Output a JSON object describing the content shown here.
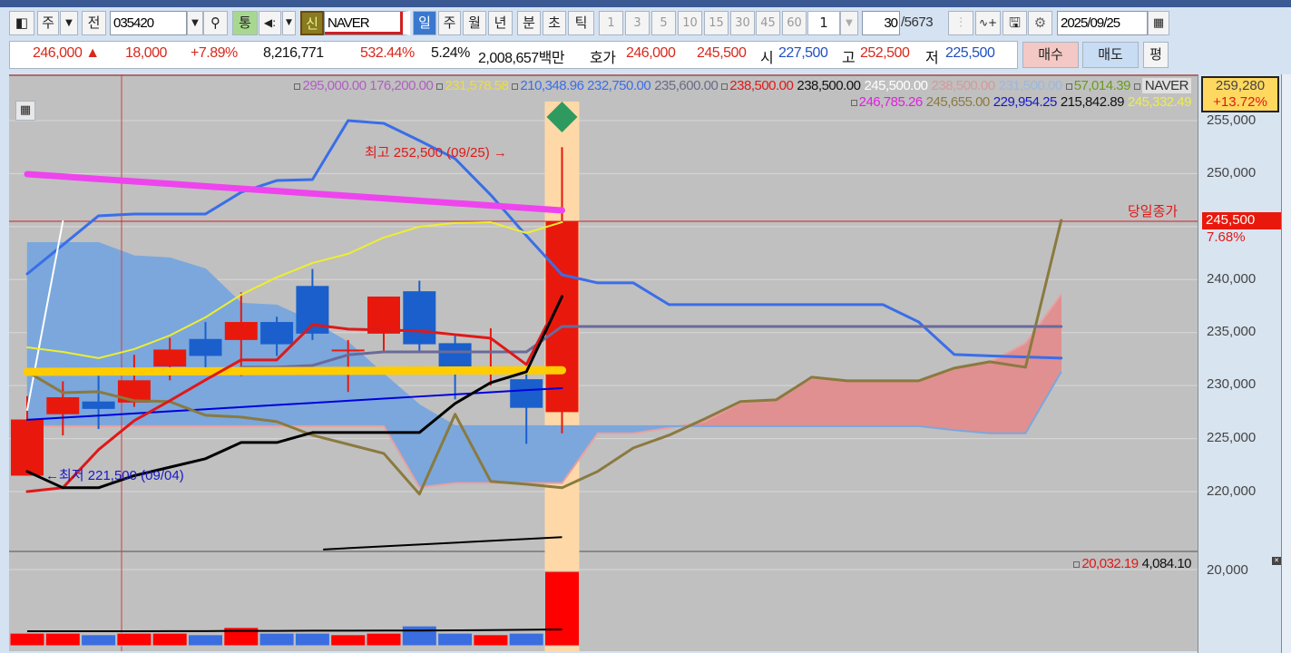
{
  "toolbar": {
    "market": "주",
    "prev": "전",
    "code": "035420",
    "tong": "통",
    "sin": "신",
    "name": "NAVER",
    "periods": [
      "일",
      "주",
      "월",
      "년",
      "분",
      "초",
      "틱"
    ],
    "intervals": [
      "1",
      "3",
      "5",
      "10",
      "15",
      "30",
      "45",
      "60"
    ],
    "multiplier": "1",
    "count": "30",
    "total": "/5673",
    "date": "2025/09/25"
  },
  "quote": {
    "price": "246,000",
    "arrow": "▲",
    "change": "18,000",
    "change_pct": "+7.89%",
    "volume": "8,216,771",
    "vol_ratio": "532.44%",
    "turnover": "5.24%",
    "amount": "2,008,657백만",
    "hoga_label": "호가",
    "ask": "246,000",
    "bid": "245,500",
    "open_label": "시",
    "open": "227,500",
    "high_label": "고",
    "high": "252,500",
    "low_label": "저",
    "low": "225,500",
    "buy": "매수",
    "sell": "매도",
    "eval": "평"
  },
  "legend": {
    "row1": [
      {
        "text": "295,000.00 176,200.00",
        "color": "#b060c0",
        "box": true
      },
      {
        "text": "231,578.58",
        "color": "#eedc40",
        "box": true
      },
      {
        "text": "210,348.96 232,750.00",
        "color": "#3a6ee8",
        "box": true
      },
      {
        "text": "235,600.00",
        "color": "#6a6a8a",
        "box": false
      },
      {
        "text": "238,500.00",
        "color": "#e01818",
        "box": true
      },
      {
        "text": "238,500.00",
        "color": "#111111",
        "box": false
      },
      {
        "text": "245,500.00",
        "color": "#ffffff",
        "box": false
      },
      {
        "text": "238,500.00",
        "color": "#d49a9a",
        "box": false
      },
      {
        "text": "231,500.00",
        "color": "#9ab8e0",
        "box": false
      },
      {
        "text": "57,014.39",
        "color": "#6a9a20",
        "box": true
      },
      {
        "text": "NAVER",
        "color": "#333333",
        "box": true
      }
    ],
    "row2": [
      {
        "text": "246,785.26",
        "color": "#e020e0",
        "box": true
      },
      {
        "text": "245,655.00",
        "color": "#8a7a40",
        "box": false
      },
      {
        "text": "229,954.25",
        "color": "#1818c8",
        "box": false
      },
      {
        "text": "215,842.89",
        "color": "#111111",
        "box": false
      },
      {
        "text": "245,332.49",
        "color": "#eeee40",
        "box": false
      }
    ],
    "volume": [
      {
        "text": "20,032.19",
        "color": "#e01818",
        "box": true
      },
      {
        "text": "4,084.10",
        "color": "#111111",
        "box": false
      }
    ]
  },
  "axis": {
    "price_ticks": [
      "255,000",
      "250,000",
      "240,000",
      "235,000",
      "230,000",
      "225,000",
      "220,000"
    ],
    "current_price": "245,500",
    "current_pct": "7.68%",
    "max_box_price": "259,280",
    "max_box_pct": "+13.72%",
    "volume_tick": "20,000",
    "close_line_label": "당일종가"
  },
  "annotations": {
    "high": "최고 252,500 (09/25) →",
    "low": "←최저 221,500 (09/04)"
  },
  "chart_data": {
    "type": "candlestick",
    "up_color": "#e8190c",
    "down_color": "#1a5fcc",
    "ylim": [
      213000,
      258000
    ],
    "candles": [
      [
        221500,
        229000,
        221500,
        226800
      ],
      [
        227300,
        230400,
        225300,
        228900
      ],
      [
        228500,
        231200,
        225900,
        227800
      ],
      [
        228400,
        232900,
        228000,
        230500
      ],
      [
        231800,
        234500,
        230500,
        233400
      ],
      [
        234400,
        236000,
        231300,
        232800
      ],
      [
        234300,
        238800,
        230900,
        236000
      ],
      [
        236000,
        236500,
        232800,
        233900
      ],
      [
        239400,
        241000,
        234300,
        234900
      ],
      [
        233400,
        234300,
        229400,
        233400
      ],
      [
        234900,
        238400,
        233300,
        238400
      ],
      [
        238900,
        239900,
        233300,
        233900
      ],
      [
        234000,
        234700,
        228700,
        231700
      ],
      [
        231700,
        235400,
        230000,
        231700
      ],
      [
        230600,
        231700,
        224500,
        227900
      ],
      [
        227500,
        252500,
        225500,
        245500
      ]
    ],
    "volumes": [
      3300,
      3300,
      2900,
      3300,
      3300,
      2900,
      4800,
      3300,
      3300,
      2900,
      3300,
      5200,
      3300,
      2900,
      3300,
      19500
    ],
    "volume_ma": [
      3800,
      3800,
      3800,
      3800,
      3850,
      3850,
      3900,
      3900,
      3950,
      3950,
      4000,
      4000,
      4050,
      4100,
      4200,
      4300
    ],
    "cloud": {
      "span_a": [
        226170,
        226170,
        226170,
        226170,
        226170,
        226170,
        226170,
        226170,
        226170,
        226170,
        226170,
        220400,
        220800,
        220800,
        220800,
        220800,
        225500,
        225500,
        226000,
        226600,
        228400,
        228600,
        230700,
        230450,
        230450,
        230450,
        231600,
        232200,
        234000,
        238600
      ],
      "span_b": [
        243450,
        243450,
        243450,
        242200,
        242000,
        240970,
        237720,
        237550,
        236010,
        234040,
        231050,
        228140,
        226170,
        226170,
        226170,
        226170,
        226170,
        226170,
        226170,
        226170,
        226170,
        226170,
        226170,
        226170,
        226170,
        226170,
        225800,
        225500,
        225500,
        231300
      ],
      "up_color": "#e09090",
      "down_color": "#7ba7dc"
    },
    "lines": [
      {
        "color": "#3a6ee8",
        "width": 3,
        "values": [
          240540,
          243270,
          246020,
          246190,
          246190,
          246190,
          248240,
          249350,
          249440,
          255000,
          254740,
          253120,
          251410,
          247990,
          244140,
          240460,
          239690,
          239690,
          237640,
          237640,
          237640,
          237640,
          237640,
          237640,
          237640,
          236010,
          232930,
          232800,
          232700,
          232590
        ]
      },
      {
        "color": "#ffffff",
        "width": 2,
        "values": [
          227700,
          245500
        ]
      },
      {
        "color": "#ee44ee",
        "width": 7,
        "values": [
          249950,
          249722,
          249494,
          249266,
          249038,
          248810,
          248582,
          248354,
          248126,
          247898,
          247670,
          247442,
          247214,
          246986,
          246758,
          246530
        ]
      },
      {
        "color": "#eeee30",
        "width": 2,
        "values": [
          233610,
          233180,
          232590,
          233440,
          234730,
          236440,
          238580,
          240210,
          241570,
          242430,
          243970,
          244990,
          245340,
          245420,
          244400,
          245420
        ]
      },
      {
        "color": "#0000dd",
        "width": 2,
        "values": [
          226770,
          226970,
          227170,
          227370,
          227570,
          227770,
          227970,
          228170,
          228370,
          228570,
          228770,
          228970,
          229170,
          229370,
          229570,
          229760
        ]
      },
      {
        "color": "#8a7a40",
        "width": 3,
        "values": [
          231300,
          229330,
          229420,
          228570,
          228490,
          227200,
          227030,
          226600,
          225320,
          224460,
          223600,
          219760,
          227300,
          220960,
          220700,
          220360,
          221900,
          224120,
          225320,
          226860,
          228490,
          228650,
          230790,
          230450,
          230450,
          230450,
          231650,
          232250,
          231730,
          245590
        ]
      },
      {
        "color": "#6a6a9a",
        "width": 3,
        "values": [
          null,
          null,
          null,
          null,
          null,
          null,
          231730,
          231730,
          231900,
          232900,
          233180,
          233180,
          233180,
          233180,
          233180,
          235580,
          235580,
          235580,
          235580,
          235580,
          235580,
          235580,
          235580,
          235580,
          235580,
          235580,
          235580,
          235580,
          235580,
          235580
        ]
      },
      {
        "color": "#ffcc00",
        "width": 9,
        "values": [
          231300,
          231310,
          231320,
          231330,
          231340,
          231350,
          231360,
          231370,
          231380,
          231390,
          231400,
          231410,
          231420,
          231430,
          231440,
          231450
        ]
      },
      {
        "color": "#e01818",
        "width": 3,
        "values": [
          220000,
          220360,
          223950,
          226690,
          228570,
          230530,
          232420,
          232420,
          235750,
          235330,
          235240,
          235160,
          234810,
          234470,
          231990,
          238580
        ]
      },
      {
        "color": "#000000",
        "width": 3,
        "values": [
          221900,
          220360,
          220360,
          221500,
          222300,
          223100,
          224630,
          224630,
          225570,
          225570,
          225570,
          225570,
          228310,
          230280,
          231300,
          238400
        ]
      }
    ],
    "trendline": {
      "color": "#000000",
      "from_index": 8.3,
      "to_index": 15,
      "values": [
        214540,
        215700
      ]
    }
  }
}
